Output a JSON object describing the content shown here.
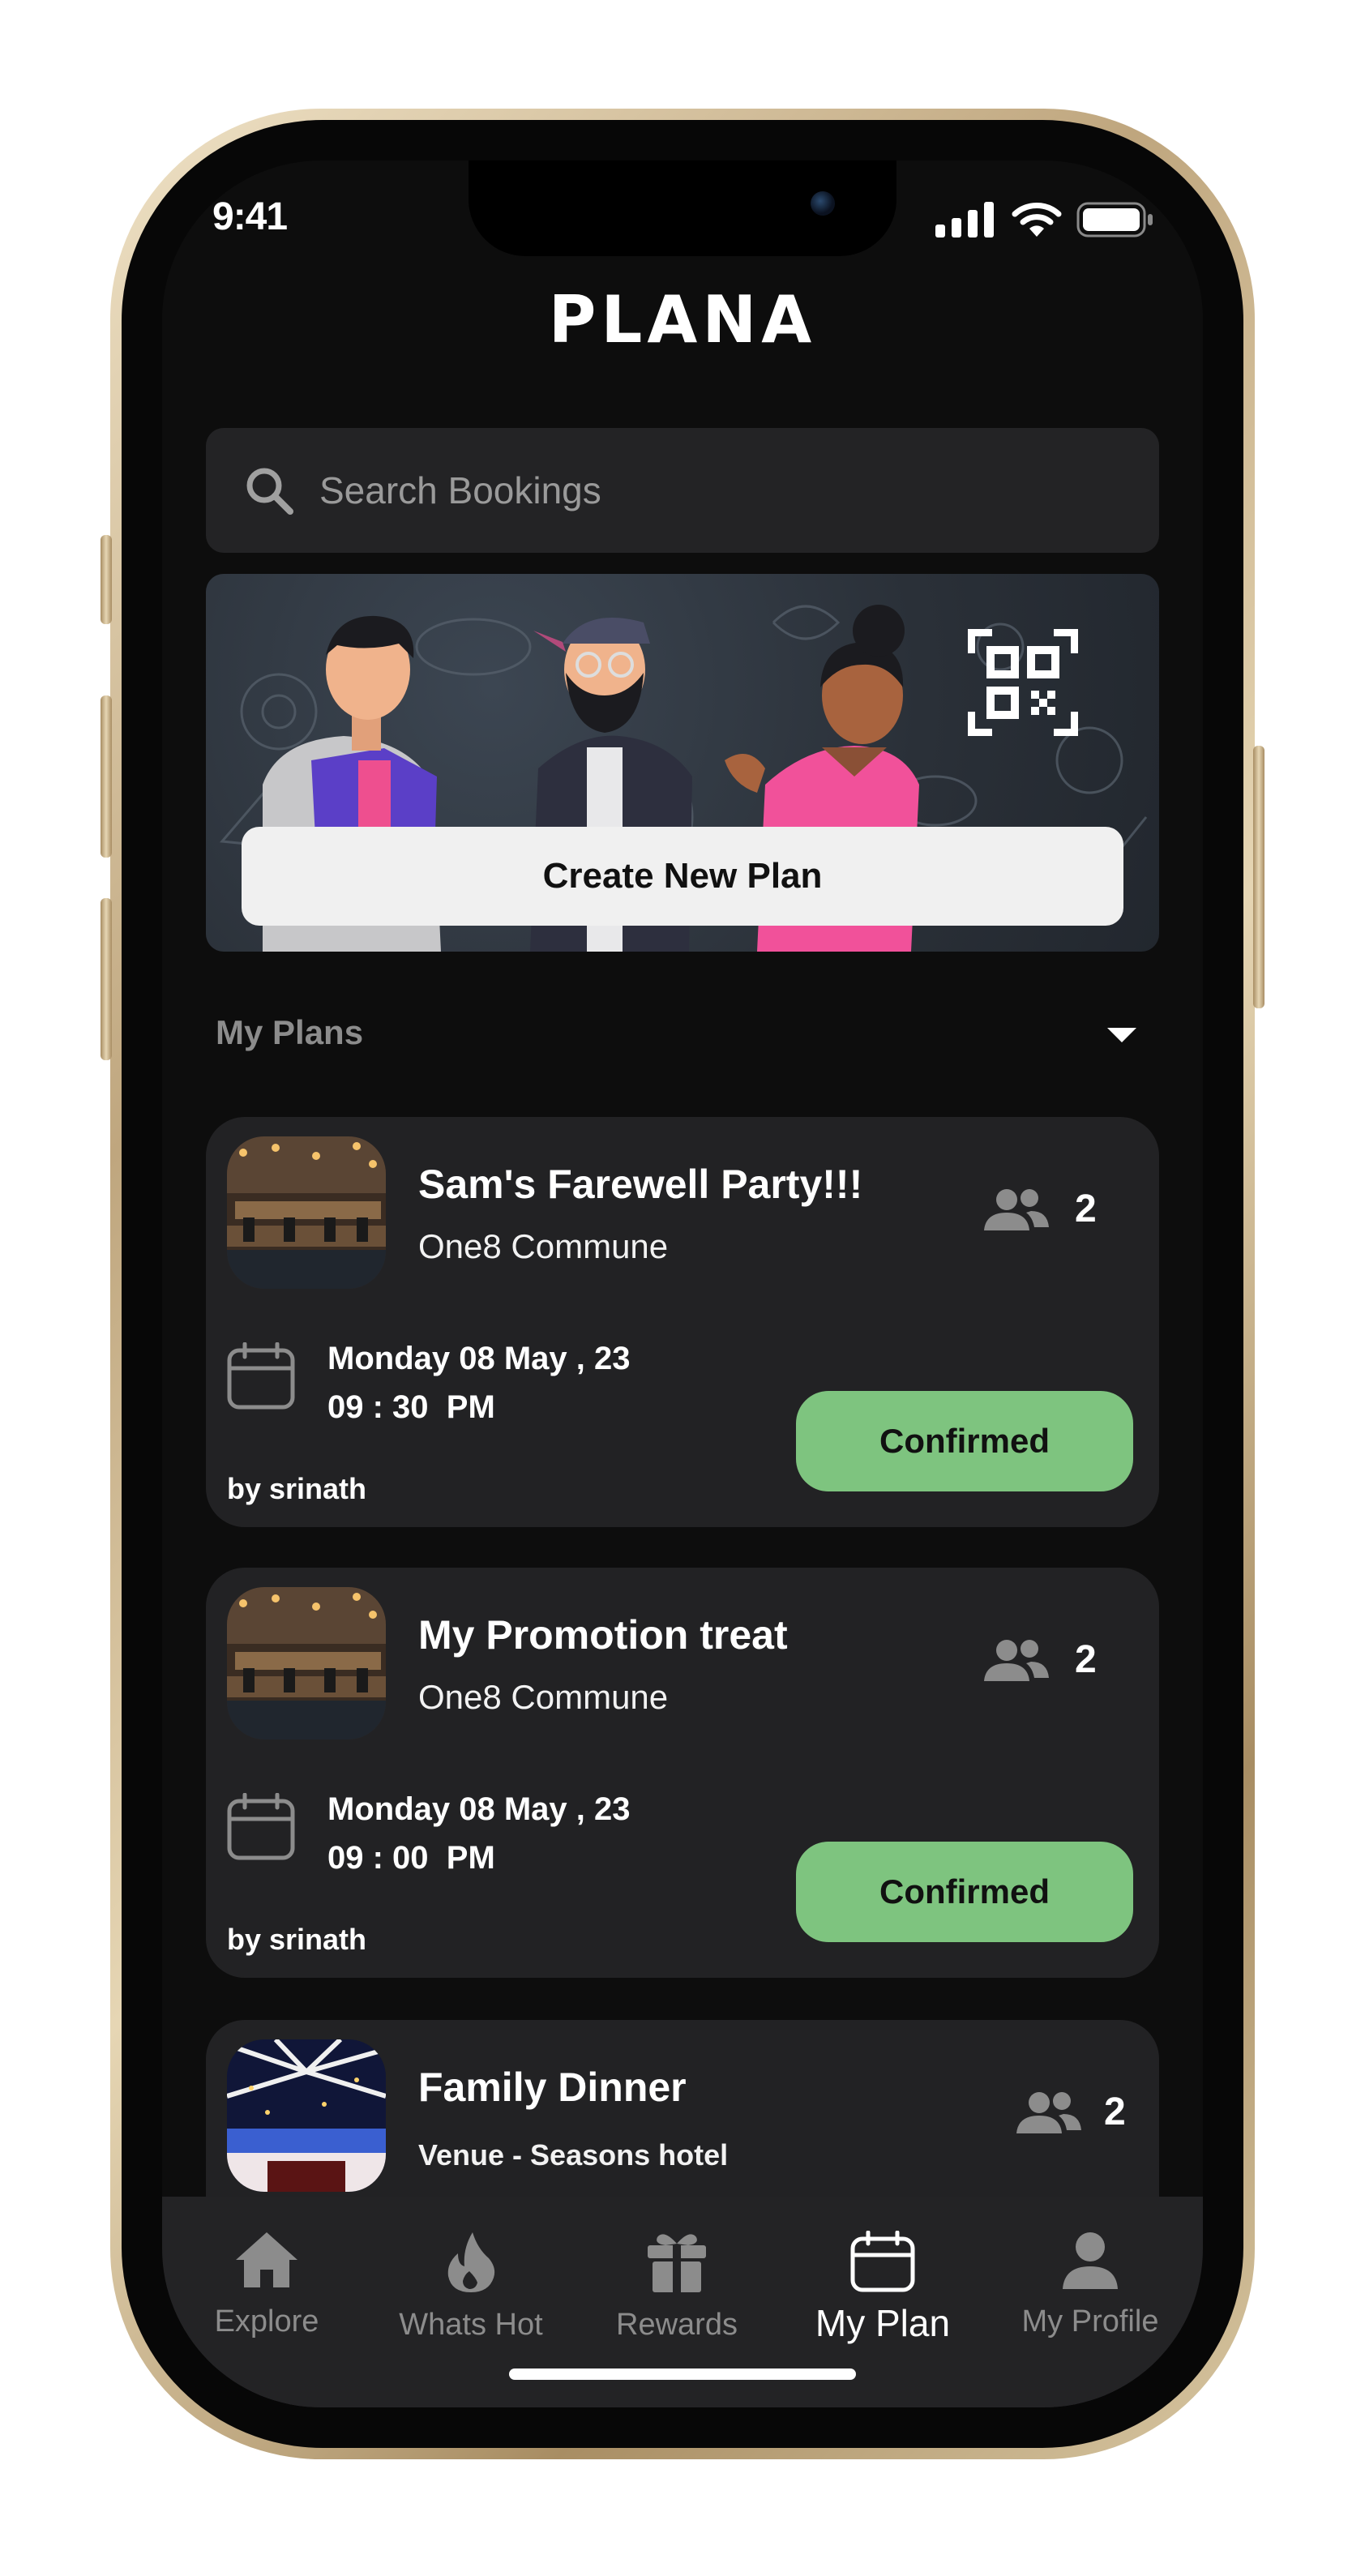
{
  "status_bar": {
    "time": "9:41"
  },
  "app": {
    "logo": "PLANA"
  },
  "search": {
    "placeholder": "Search Bookings"
  },
  "banner": {
    "button_label": "Create New Plan",
    "qr_icon": "qr-code-icon"
  },
  "section": {
    "title": "My Plans"
  },
  "plans": [
    {
      "title": "Sam's Farewell Party!!!",
      "venue": "One8 Commune",
      "people": "2",
      "date": "Monday 08 May , 23",
      "time": "09 : 30  PM",
      "by": "by srinath",
      "status": "Confirmed"
    },
    {
      "title": "My Promotion treat",
      "venue": "One8 Commune",
      "people": "2",
      "date": "Monday 08 May , 23",
      "time": "09 : 00  PM",
      "by": "by srinath",
      "status": "Confirmed"
    },
    {
      "title": "Family Dinner",
      "venue": "Venue - Seasons hotel",
      "people": "2"
    }
  ],
  "tabs": [
    {
      "label": "Explore",
      "icon": "home-icon"
    },
    {
      "label": "Whats Hot",
      "icon": "flame-icon"
    },
    {
      "label": "Rewards",
      "icon": "gift-icon"
    },
    {
      "label": "My Plan",
      "icon": "calendar-icon",
      "active": true
    },
    {
      "label": "My Profile",
      "icon": "person-icon"
    }
  ],
  "colors": {
    "background": "#0d0d0d",
    "card": "#222224",
    "confirmed": "#7ec47f",
    "muted_text": "#8c8c8c"
  }
}
